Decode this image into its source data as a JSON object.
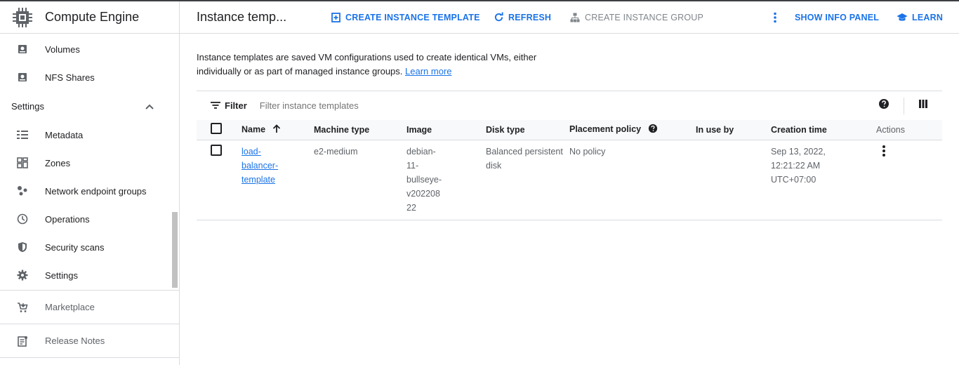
{
  "sidebar": {
    "title": "Compute Engine",
    "items_top": [
      {
        "label": "Volumes",
        "icon": "disk-icon"
      },
      {
        "label": "NFS Shares",
        "icon": "disk-icon"
      }
    ],
    "section": {
      "label": "Settings",
      "expanded": true
    },
    "items_settings": [
      {
        "label": "Metadata",
        "icon": "list-icon"
      },
      {
        "label": "Zones",
        "icon": "grid-icon"
      },
      {
        "label": "Network endpoint groups",
        "icon": "dots-icon"
      },
      {
        "label": "Operations",
        "icon": "clock-icon"
      },
      {
        "label": "Security scans",
        "icon": "shield-icon"
      },
      {
        "label": "Settings",
        "icon": "gear-icon"
      }
    ],
    "marketplace": "Marketplace",
    "release_notes": "Release Notes"
  },
  "header": {
    "title": "Instance temp...",
    "create_btn": "CREATE INSTANCE TEMPLATE",
    "refresh_btn": "REFRESH",
    "create_group_btn": "CREATE INSTANCE GROUP",
    "info_panel_btn": "SHOW INFO PANEL",
    "learn_btn": "LEARN"
  },
  "description": {
    "text": "Instance templates are saved VM configurations used to create identical VMs, either individually or as part of managed instance groups.",
    "link": "Learn more"
  },
  "filter": {
    "label": "Filter",
    "placeholder": "Filter instance templates"
  },
  "table": {
    "headers": {
      "name": "Name",
      "machine_type": "Machine type",
      "image": "Image",
      "disk_type": "Disk type",
      "placement_policy": "Placement policy",
      "in_use_by": "In use by",
      "creation_time": "Creation time",
      "actions": "Actions"
    },
    "rows": [
      {
        "name": "load-balancer-template",
        "machine_type": "e2-medium",
        "image": "debian-11-bullseye-v20220822",
        "disk_type": "Balanced persistent disk",
        "placement_policy": "No policy",
        "in_use_by": "",
        "creation_time": "Sep 13, 2022, 12:21:22 AM UTC+07:00"
      }
    ]
  },
  "colors": {
    "accent": "#1a73e8",
    "border": "#dadce0",
    "muted": "#5f6368"
  }
}
